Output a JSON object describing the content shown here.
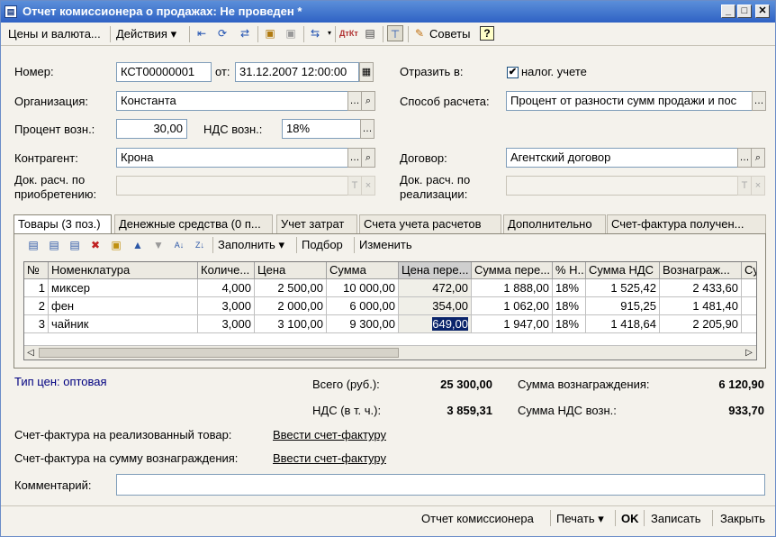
{
  "window": {
    "title": "Отчет комиссионера о продажах: Не проведен *",
    "minimize": "_",
    "maximize": "□",
    "close": "✕"
  },
  "toolbar": {
    "prices_label": "Цены и валюта...",
    "actions_label": "Действия",
    "tips_label": "Советы",
    "help_label": "?",
    "dtkt_label": "ДтКт"
  },
  "form": {
    "number_label": "Номер:",
    "number_value": "КСТ00000001",
    "date_label": "от:",
    "date_value": "31.12.2007 12:00:00",
    "reflect_label": "Отразить в:",
    "tax_label": "налог. учете",
    "tax_checked": "✔",
    "org_label": "Организация:",
    "org_value": "Константа",
    "calc_method_label": "Способ расчета:",
    "calc_method_value": "Процент от разности сумм продажи и пос",
    "percent_label": "Процент возн.:",
    "percent_value": "30,00",
    "vat_label": "НДС возн.:",
    "vat_value": "18%",
    "contractor_label": "Контрагент:",
    "contractor_value": "Крона",
    "contract_label": "Договор:",
    "contract_value": "Агентский договор",
    "doc_purchase_label_1": "Док. расч. по",
    "doc_purchase_label_2": "приобретению:",
    "doc_sale_label_1": "Док. расч. по",
    "doc_sale_label_2": "реализации:"
  },
  "tabs": [
    "Товары (3 поз.)",
    "Денежные средства (0 п...",
    "Учет затрат",
    "Счета учета расчетов",
    "Дополнительно",
    "Счет-фактура получен..."
  ],
  "grid_toolbar": {
    "fill_label": "Заполнить",
    "select_label": "Подбор",
    "edit_label": "Изменить"
  },
  "grid": {
    "headers": [
      "№",
      "Номенклатура",
      "Количе...",
      "Цена",
      "Сумма",
      "Цена пере...",
      "Сумма пере...",
      "% Н...",
      "Сумма НДС",
      "Вознаграж...",
      "Су"
    ],
    "rows": [
      [
        "1",
        "миксер",
        "4,000",
        "2 500,00",
        "10 000,00",
        "472,00",
        "1 888,00",
        "18%",
        "1 525,42",
        "2 433,60"
      ],
      [
        "2",
        "фен",
        "3,000",
        "2 000,00",
        "6 000,00",
        "354,00",
        "1 062,00",
        "18%",
        "915,25",
        "1 481,40"
      ],
      [
        "3",
        "чайник",
        "3,000",
        "3 100,00",
        "9 300,00",
        "649,00",
        "1 947,00",
        "18%",
        "1 418,64",
        "2 205,90"
      ]
    ]
  },
  "summary": {
    "price_type": "Тип цен: оптовая",
    "total_label": "Всего (руб.):",
    "total_value": "25 300,00",
    "vat_total_label": "НДС (в т. ч.):",
    "vat_total_value": "3 859,31",
    "reward_label": "Сумма вознаграждения:",
    "reward_value": "6 120,90",
    "reward_vat_label": "Сумма НДС возн.:",
    "reward_vat_value": "933,70",
    "invoice_goods_label": "Счет-фактура на реализованный товар:",
    "invoice_goods_link": "Ввести счет-фактуру",
    "invoice_reward_label": "Счет-фактура на сумму вознаграждения:",
    "invoice_reward_link": "Ввести счет-фактуру",
    "comment_label": "Комментарий:",
    "comment_value": ""
  },
  "bottom": {
    "report_label": "Отчет комиссионера",
    "print_label": "Печать",
    "ok_label": "OK",
    "save_label": "Записать",
    "close_label": "Закрыть"
  },
  "colors": {
    "title_bar": "#2f62c4",
    "selection": "#0a246a",
    "link": "#000080"
  }
}
